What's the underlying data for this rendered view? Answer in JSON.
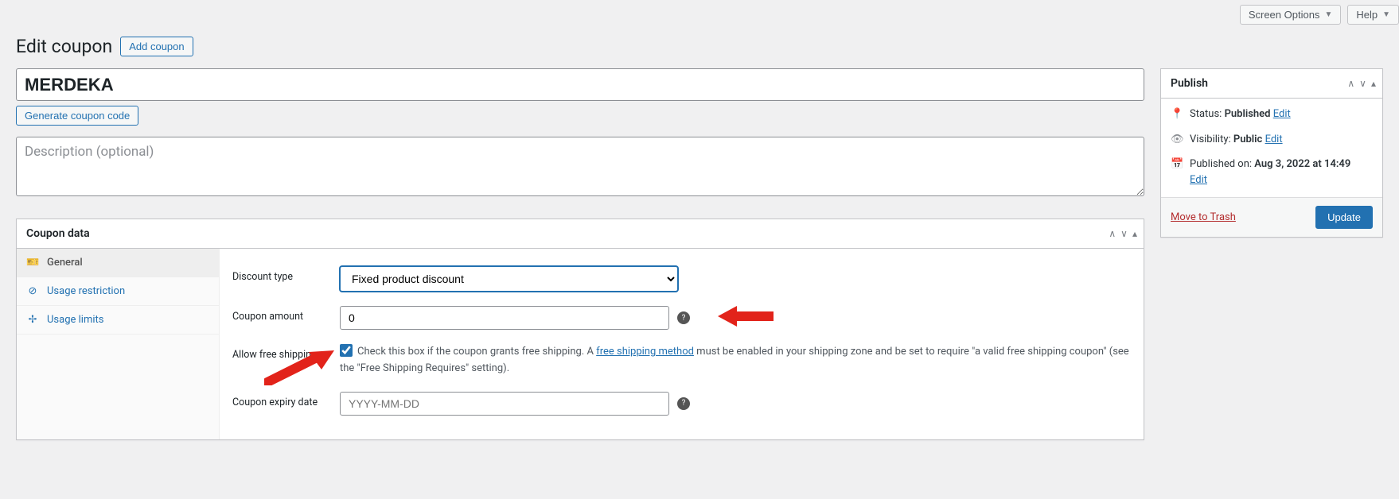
{
  "topbar": {
    "screen_options": "Screen Options",
    "help": "Help"
  },
  "header": {
    "title": "Edit coupon",
    "add_coupon": "Add coupon"
  },
  "coupon": {
    "code": "MERDEKA",
    "generate_btn": "Generate coupon code",
    "desc_placeholder": "Description (optional)"
  },
  "coupon_data": {
    "title": "Coupon data",
    "tabs": {
      "general": "General",
      "usage_restriction": "Usage restriction",
      "usage_limits": "Usage limits"
    },
    "general": {
      "discount_type": {
        "label": "Discount type",
        "value": "Fixed product discount"
      },
      "coupon_amount": {
        "label": "Coupon amount",
        "value": "0"
      },
      "free_shipping": {
        "label": "Allow free shipping",
        "desc_before": "Check this box if the coupon grants free shipping. A ",
        "link": "free shipping method",
        "desc_after": " must be enabled in your shipping zone and be set to require \"a valid free shipping coupon\" (see the \"Free Shipping Requires\" setting)."
      },
      "expiry": {
        "label": "Coupon expiry date",
        "placeholder": "YYYY-MM-DD"
      }
    }
  },
  "publish": {
    "title": "Publish",
    "status": {
      "label": "Status:",
      "value": "Published",
      "edit": "Edit"
    },
    "visibility": {
      "label": "Visibility:",
      "value": "Public",
      "edit": "Edit"
    },
    "published_on": {
      "label": "Published on:",
      "value": "Aug 3, 2022 at 14:49",
      "edit": "Edit"
    },
    "trash": "Move to Trash",
    "update": "Update"
  }
}
